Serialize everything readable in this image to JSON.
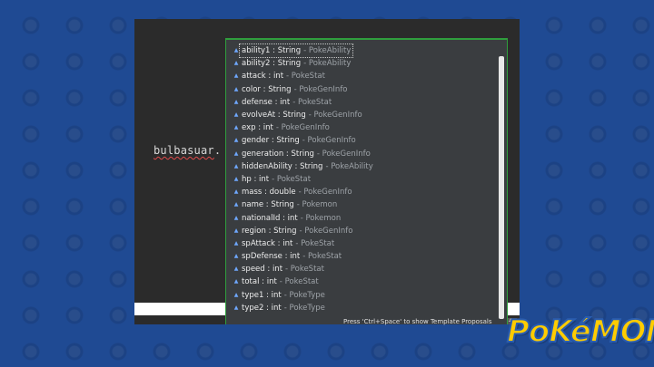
{
  "editor": {
    "code_identifier": "bulbasuar",
    "code_dot": "."
  },
  "popup": {
    "items": [
      {
        "decl": "ability1 : String",
        "owner": "- PokeAbility",
        "selected": true
      },
      {
        "decl": "ability2 : String",
        "owner": "- PokeAbility"
      },
      {
        "decl": "attack : int",
        "owner": "- PokeStat"
      },
      {
        "decl": "color : String",
        "owner": "- PokeGenInfo"
      },
      {
        "decl": "defense : int",
        "owner": "- PokeStat"
      },
      {
        "decl": "evolveAt : String",
        "owner": "- PokeGenInfo"
      },
      {
        "decl": "exp : int",
        "owner": "- PokeGenInfo"
      },
      {
        "decl": "gender : String",
        "owner": "- PokeGenInfo"
      },
      {
        "decl": "generation : String",
        "owner": "- PokeGenInfo"
      },
      {
        "decl": "hiddenAbility : String",
        "owner": "- PokeAbility"
      },
      {
        "decl": "hp : int",
        "owner": "- PokeStat"
      },
      {
        "decl": "mass : double",
        "owner": "- PokeGenInfo"
      },
      {
        "decl": "name : String",
        "owner": "- Pokemon"
      },
      {
        "decl": "nationalId : int",
        "owner": "- Pokemon"
      },
      {
        "decl": "region : String",
        "owner": "- PokeGenInfo"
      },
      {
        "decl": "spAttack : int",
        "owner": "- PokeStat"
      },
      {
        "decl": "spDefense : int",
        "owner": "- PokeStat"
      },
      {
        "decl": "speed : int",
        "owner": "- PokeStat"
      },
      {
        "decl": "total : int",
        "owner": "- PokeStat"
      },
      {
        "decl": "type1 : int",
        "owner": "- PokeType"
      },
      {
        "decl": "type2 : int",
        "owner": "- PokeType"
      }
    ],
    "item_icon": "field-icon",
    "status_hint": "Press 'Ctrl+Space' to show Template Proposals",
    "side_tag": "40"
  },
  "logo": {
    "text": "POKéMON"
  },
  "colors": {
    "background": "#1f4a93",
    "editor_bg": "#2b2b2b",
    "popup_border": "#2f9e3d",
    "logo_yellow": "#ffcc00"
  }
}
